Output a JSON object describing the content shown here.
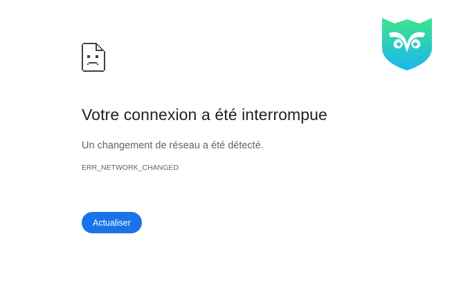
{
  "error": {
    "title": "Votre connexion a été interrompue",
    "message": "Un changement de réseau a été détecté.",
    "code": "ERR_NETWORK_CHANGED"
  },
  "actions": {
    "reload_label": "Actualiser"
  },
  "icons": {
    "error_icon": "sad-document-icon",
    "logo": "owl-logo-icon"
  },
  "colors": {
    "button_bg": "#1a73e8",
    "title_text": "#202124",
    "secondary_text": "#5f6368",
    "logo_gradient_top": "#3fe38a",
    "logo_gradient_bottom": "#18b7f2"
  }
}
